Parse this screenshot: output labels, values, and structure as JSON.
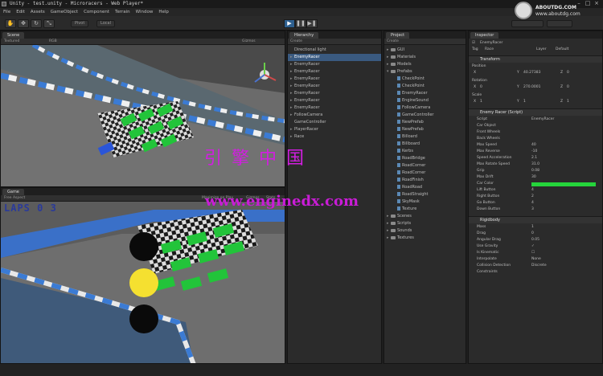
{
  "window": {
    "title": "Unity - test.unity - Microracers - Web Player*"
  },
  "menu": [
    "File",
    "Edit",
    "Assets",
    "GameObject",
    "Component",
    "Terrain",
    "Window",
    "Help"
  ],
  "toolbar": {
    "pivot": "Pivot",
    "local": "Local"
  },
  "scene": {
    "tab": "Scene",
    "mode": "RGB"
  },
  "game": {
    "tab": "Game",
    "aspect": "Free Aspect",
    "maximize": "Maximize on Play",
    "gizmos": "Gizmos",
    "stats": "Stats",
    "lap": "LAPS 0 3"
  },
  "hierarchy": {
    "tab": "Hierarchy",
    "create": "Create",
    "items": [
      "Directional light",
      "EnemyRacer",
      "EnemyRacer",
      "EnemyRacer",
      "EnemyRacer",
      "EnemyRacer",
      "EnemyRacer",
      "EnemyRacer",
      "EnemyRacer",
      "FollowCamera",
      "GameController",
      "PlayerRacer",
      "Race"
    ]
  },
  "project": {
    "tab": "Project",
    "create": "Create",
    "items": [
      "GUI",
      "Materials",
      "Models",
      "Prefabs",
      "CheckPoint",
      "CheckPoint",
      "EnemyRacer",
      "EngineSound",
      "FollowCamera",
      "GameController",
      "NewPrefab",
      "NewPrefab",
      "Billoard",
      "Billboard",
      "Kerbs",
      "RoadBridge",
      "RoadCorner",
      "RoadCorner",
      "RoadFinish",
      "RoadRoad",
      "RoadStraight",
      "SkyMask",
      "Texture",
      "Scenes",
      "Scripts",
      "Sounds",
      "Textures"
    ]
  },
  "inspector": {
    "tab": "Inspector",
    "object_name": "EnemyRacer",
    "tag_label": "Tag",
    "tag_value": "Race",
    "layer_label": "Layer",
    "layer_value": "Default",
    "transform": {
      "title": "Transform",
      "position": "Position",
      "rotation": "Rotation",
      "scale": "Scale",
      "x": "X",
      "y": "Y",
      "z": "Z",
      "pos_values": [
        "",
        "40.27383",
        "0"
      ],
      "rot_values": [
        "0",
        "270.0001",
        "0"
      ],
      "scale_values": [
        "1",
        "1",
        "1"
      ]
    },
    "script": {
      "title": "Enemy Racer (Script)",
      "fields": [
        {
          "label": "Script",
          "value": "EnemyRacer"
        },
        {
          "label": "Car Object",
          "value": ""
        },
        {
          "label": "Front Wheels",
          "value": ""
        },
        {
          "label": "Back Wheels",
          "value": ""
        },
        {
          "label": "Max Speed",
          "value": "40"
        },
        {
          "label": "Max Reverse",
          "value": "-10"
        },
        {
          "label": "Speed Acceleration",
          "value": "2.1"
        },
        {
          "label": "Max Rotate Speed",
          "value": "31.0"
        },
        {
          "label": "Grip",
          "value": "0.08"
        },
        {
          "label": "Max Drift",
          "value": "30"
        },
        {
          "label": "Car Color",
          "value": ""
        },
        {
          "label": "Lift Button",
          "value": "4"
        },
        {
          "label": "Right Button",
          "value": "2"
        },
        {
          "label": "Go Button",
          "value": "4"
        },
        {
          "label": "Down Button",
          "value": "3"
        }
      ]
    },
    "rigidbody": {
      "title": "Rigidbody",
      "fields": [
        {
          "label": "Mass",
          "value": "1"
        },
        {
          "label": "Drag",
          "value": "0"
        },
        {
          "label": "Angular Drag",
          "value": "0.05"
        },
        {
          "label": "Use Gravity",
          "value": "✓"
        },
        {
          "label": "Is Kinematic",
          "value": "☐"
        },
        {
          "label": "Interpolate",
          "value": "None"
        },
        {
          "label": "Collision Detection",
          "value": "Discrete"
        },
        {
          "label": "Constraints",
          "value": ""
        }
      ]
    }
  },
  "watermark": {
    "chinese": "引擎中国",
    "url": "www.enginedx.com",
    "corner": "ABOUTDG.COM",
    "corner_sub": "www.aboutdg.com"
  },
  "colors": {
    "car_color": "#25d43b",
    "accent": "#3a5a80"
  }
}
